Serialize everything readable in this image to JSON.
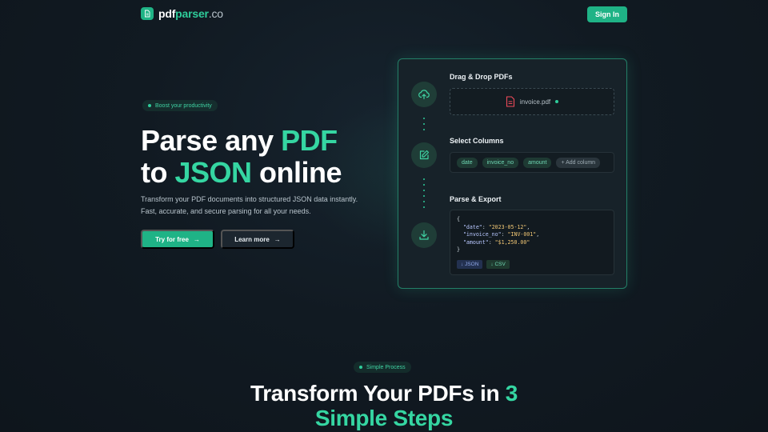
{
  "header": {
    "logo_part1": "pdf",
    "logo_part2": "parser",
    "logo_part3": ".co",
    "logo_icon": "document-icon",
    "signin_label": "Sign In"
  },
  "hero": {
    "badge": "Boost your productivity",
    "title_line1_prefix": "Parse any ",
    "title_line1_accent": "PDF",
    "title_line2_prefix": "to ",
    "title_line2_accent": "JSON",
    "title_line2_suffix": " online",
    "description_line1": "Transform your PDF documents into structured JSON data instantly.",
    "description_line2": "Fast, accurate, and secure parsing for all your needs.",
    "primary_button": "Try for free",
    "secondary_button": "Learn more"
  },
  "card": {
    "step1": {
      "title": "Drag & Drop PDFs",
      "file_name": "invoice.pdf",
      "icon": "upload-icon"
    },
    "step2": {
      "title": "Select Columns",
      "icon": "edit-icon",
      "columns": [
        "date",
        "invoice_no",
        "amount"
      ],
      "add_label": "+ Add column"
    },
    "step3": {
      "title": "Parse & Export",
      "icon": "download-icon",
      "code": {
        "open": "{",
        "date_key": "\"date\"",
        "date_val": "\"2023-05-12\"",
        "invoice_key": "\"invoice_no\"",
        "invoice_val": "\"INV-001\"",
        "amount_key": "\"amount\"",
        "amount_val": "\"$1,250.00\"",
        "close": "}"
      },
      "export_json": "↓ JSON",
      "export_csv": "↓ CSV"
    }
  },
  "process": {
    "badge": "Simple Process",
    "title_prefix": "Transform Your PDFs in ",
    "title_accent_num": "3",
    "title_line2": "Simple Steps"
  },
  "colors": {
    "accent": "#2ecc9a",
    "button": "#1fb386",
    "background": "#111a22"
  }
}
